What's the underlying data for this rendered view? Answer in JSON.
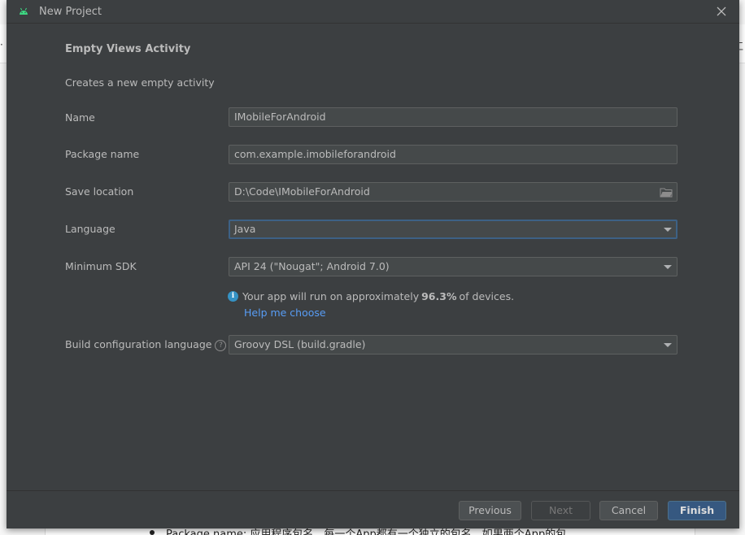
{
  "background": {
    "bottom_text": "Package name: 应用程序包名，每一个App都有一个独立的包名，如果两个App的包",
    "right_glyph": "工",
    "left_glyph": "·"
  },
  "dialog": {
    "title": "New Project",
    "heading": "Empty Views Activity",
    "description": "Creates a new empty activity"
  },
  "form": {
    "name_label": "Name",
    "name_value": "IMobileForAndroid",
    "package_label": "Package name",
    "package_value": "com.example.imobileforandroid",
    "save_label": "Save location",
    "save_value": "D:\\Code\\IMobileForAndroid",
    "language_label": "Language",
    "language_value": "Java",
    "sdk_label": "Minimum SDK",
    "sdk_value": "API 24 (\"Nougat\"; Android 7.0)",
    "info_prefix": "Your app will run on approximately",
    "info_percent": "96.3%",
    "info_suffix": "of devices.",
    "help_link": "Help me choose",
    "build_label": "Build configuration language",
    "build_value": "Groovy DSL (build.gradle)"
  },
  "footer": {
    "previous": "Previous",
    "next": "Next",
    "cancel": "Cancel",
    "finish": "Finish"
  },
  "colors": {
    "dialog_bg": "#3c3f41",
    "field_bg": "#45494a",
    "focus_border": "#3d6185",
    "link": "#589df6",
    "info_icon": "#3592c4",
    "primary_button": "#365880"
  }
}
